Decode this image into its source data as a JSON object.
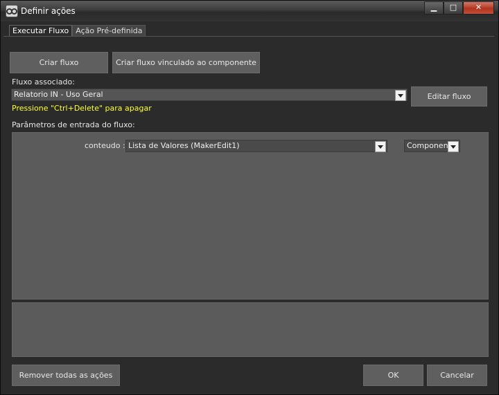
{
  "window": {
    "title": "Definir ações"
  },
  "tabs": [
    "Executar Fluxo",
    "Ação Pré-definida"
  ],
  "buttons": {
    "criar_fluxo": "Criar fluxo",
    "criar_fluxo_vinculado": "Criar fluxo vinculado ao componente",
    "editar_fluxo": "Editar fluxo",
    "remover_todas": "Remover todas as ações",
    "ok": "OK",
    "cancelar": "Cancelar"
  },
  "fluxo": {
    "label": "Fluxo associado:",
    "value": "Relatorio IN - Uso Geral",
    "hint": "Pressione \"Ctrl+Delete\" para apagar"
  },
  "params": {
    "label": "Parâmetros de entrada do fluxo:",
    "rows": [
      {
        "name": "conteudo :",
        "value": "Lista de Valores (MakerEdit1)",
        "type": "Componente"
      }
    ]
  },
  "colors": {
    "hint": "#ffff33",
    "background": "#2b2b2b",
    "field": "#5b5b5b"
  },
  "icons": {
    "app": "glasses-icon",
    "minimize": "minimize-icon",
    "maximize": "maximize-icon",
    "close": "close-icon",
    "dropdown": "chevron-down-icon"
  }
}
